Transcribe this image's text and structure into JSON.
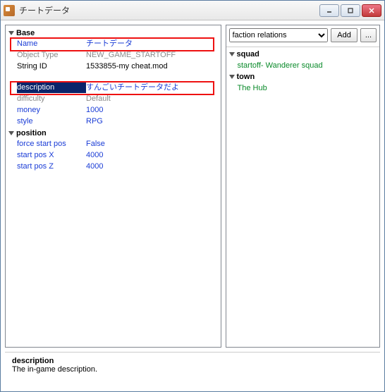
{
  "window": {
    "title": "チートデータ"
  },
  "dropdown": {
    "selected": "faction relations",
    "add_label": "Add",
    "more_label": "..."
  },
  "groups": {
    "base": {
      "label": "Base",
      "name_label": "Name",
      "name_value": "チートデータ",
      "object_type_label": "Object Type",
      "object_type_value": "NEW_GAME_STARTOFF",
      "string_id_label": "String ID",
      "string_id_value": "1533855-my cheat.mod"
    },
    "desc": {
      "description_label": "description",
      "description_value": "すんごいチートデータだよ",
      "difficulty_label": "difficulty",
      "difficulty_value": "Default",
      "money_label": "money",
      "money_value": "1000",
      "style_label": "style",
      "style_value": "RPG"
    },
    "position": {
      "label": "position",
      "force_start_label": "force start pos",
      "force_start_value": "False",
      "start_x_label": "start pos X",
      "start_x_value": "4000",
      "start_z_label": "start pos Z",
      "start_z_value": "4000"
    }
  },
  "right": {
    "squad_label": "squad",
    "squad_item": "startoff- Wanderer squad",
    "town_label": "town",
    "town_item": "The Hub"
  },
  "footer": {
    "name": "description",
    "text": "The in-game description."
  }
}
